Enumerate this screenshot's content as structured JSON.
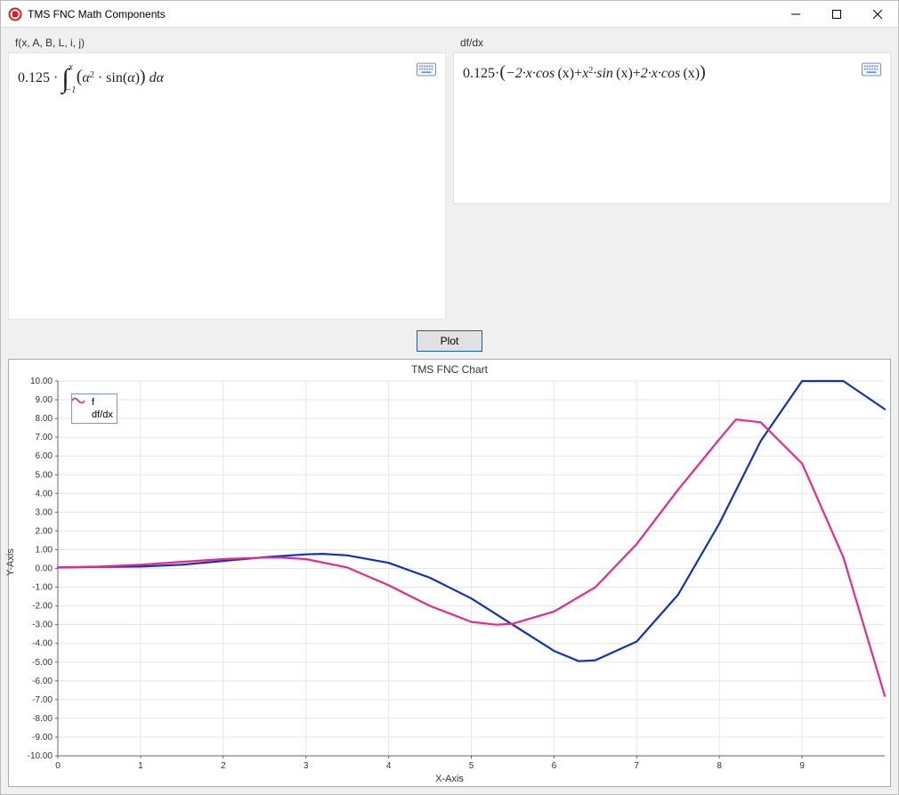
{
  "window": {
    "title": "TMS FNC Math Components"
  },
  "left_panel": {
    "label": "f(x, A, B, L, i, j)",
    "formula_parts": {
      "coeff": "0.125",
      "dot": " · ",
      "int_lower": "−1",
      "int_upper": "x",
      "body_open": "(",
      "alpha": "α",
      "pw2": "2",
      "dot2": " · ",
      "sin": "sin",
      "body_close": ")",
      "dalpha": " dα"
    }
  },
  "right_panel": {
    "label": "df/dx",
    "formula_parts": {
      "coeff": "0.125",
      "dot": "·",
      "open": "(",
      "t1a": "−2·x·cos",
      "t1x": "(x)",
      "plus1": "+",
      "t2a": "x",
      "t2pw": "2",
      "t2b": "·sin",
      "t2x": "(x)",
      "plus2": "+",
      "t3a": "2·x·cos",
      "t3x": "(x)",
      "close": ")"
    }
  },
  "buttons": {
    "plot": "Plot"
  },
  "chart": {
    "title": "TMS FNC Chart",
    "xlabel": "X-Axis",
    "ylabel": "Y-Axis",
    "legend": {
      "f": "f",
      "dfdx": "df/dx"
    }
  },
  "chart_data": {
    "type": "line",
    "title": "TMS FNC Chart",
    "xlabel": "X-Axis",
    "ylabel": "Y-Axis",
    "xlim": [
      0,
      10
    ],
    "ylim": [
      -10,
      10
    ],
    "xticks": [
      0,
      1,
      2,
      3,
      4,
      5,
      6,
      7,
      8,
      9
    ],
    "yticks": [
      -10,
      -9,
      -8,
      -7,
      -6,
      -5,
      -4,
      -3,
      -2,
      -1,
      0,
      1,
      2,
      3,
      4,
      5,
      6,
      7,
      8,
      9,
      10
    ],
    "series": [
      {
        "name": "f",
        "color": "#1030c0",
        "x": [
          0.0,
          0.5,
          1.0,
          1.5,
          2.0,
          2.5,
          3.0,
          3.2,
          3.5,
          4.0,
          4.5,
          5.0,
          5.5,
          6.0,
          6.3,
          6.5,
          7.0,
          7.5,
          8.0,
          8.5,
          9.0,
          9.5,
          10.0
        ],
        "values": [
          0.05,
          0.08,
          0.1,
          0.2,
          0.4,
          0.6,
          0.75,
          0.78,
          0.7,
          0.3,
          -0.5,
          -1.6,
          -3.0,
          -4.4,
          -4.95,
          -4.9,
          -3.9,
          -1.4,
          2.4,
          6.8,
          10.0,
          10.0,
          8.5
        ]
      },
      {
        "name": "df/dx",
        "color": "#e52a8c",
        "x": [
          0.0,
          0.5,
          1.0,
          1.5,
          2.0,
          2.5,
          2.7,
          3.0,
          3.5,
          4.0,
          4.5,
          5.0,
          5.3,
          5.5,
          6.0,
          6.5,
          7.0,
          7.5,
          8.0,
          8.2,
          8.5,
          9.0,
          9.5,
          10.0
        ],
        "values": [
          0.05,
          0.1,
          0.2,
          0.35,
          0.5,
          0.58,
          0.58,
          0.5,
          0.05,
          -0.9,
          -2.0,
          -2.85,
          -3.0,
          -2.95,
          -2.3,
          -1.0,
          1.3,
          4.2,
          6.9,
          7.95,
          7.8,
          5.6,
          0.6,
          -6.8
        ]
      }
    ]
  }
}
